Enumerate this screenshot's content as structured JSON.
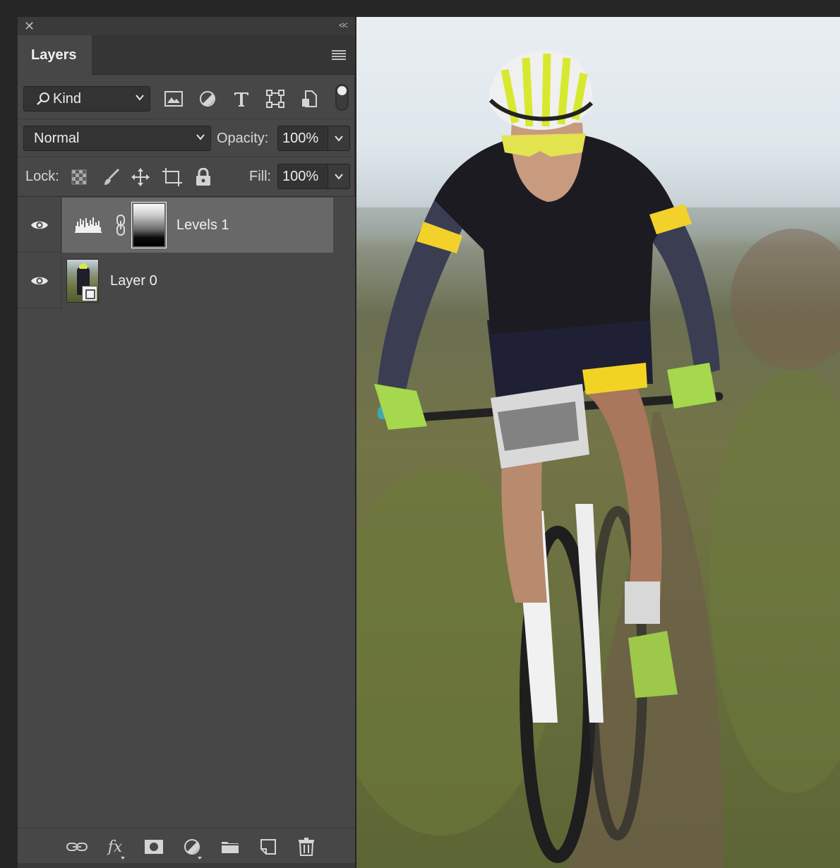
{
  "panel": {
    "tab_label": "Layers",
    "filter": {
      "kind_label": "Kind"
    },
    "blend_mode": "Normal",
    "opacity_label": "Opacity:",
    "opacity_value": "100%",
    "lock_label": "Lock:",
    "fill_label": "Fill:",
    "fill_value": "100%"
  },
  "layers": [
    {
      "name": "Levels 1",
      "type": "adjustment-levels",
      "visible": true,
      "selected": true
    },
    {
      "name": "Layer 0",
      "type": "smart-object",
      "visible": true,
      "selected": false
    }
  ],
  "bottom_bar": {
    "fx_label": "fx"
  },
  "colors": {
    "panel_bg": "#474747",
    "selected_row": "#686868",
    "helmet_accent": "#d9e94a"
  }
}
